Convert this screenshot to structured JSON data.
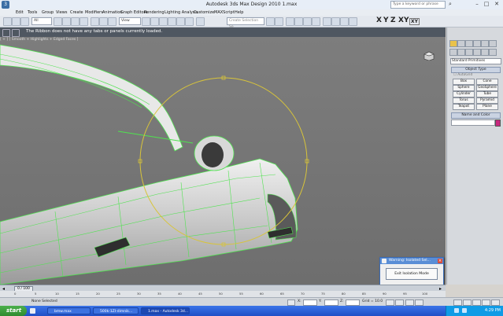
{
  "window": {
    "title": "Autodesk 3ds Max Design 2010     1.max",
    "search_placeholder": "Type a keyword or phrase"
  },
  "menu": {
    "items": [
      "Edit",
      "Tools",
      "Group",
      "Views",
      "Create",
      "Modifiers",
      "Animation",
      "Graph Editors",
      "Rendering",
      "Lighting Analysis",
      "Customize",
      "MAXScript",
      "Help"
    ]
  },
  "toolbar": {
    "filter_value": "All",
    "refcoord_value": "View",
    "named_selection_placeholder": "Create Selection Se",
    "axes": [
      "X",
      "Y",
      "Z",
      "XY",
      "XY"
    ]
  },
  "ribbon": {
    "message": "The Ribbon does not have any tabs or panels currently loaded."
  },
  "viewport": {
    "label": "[ + ] [ Smooth + Highlights + Edged Faces ]"
  },
  "command_panel": {
    "category_dropdown": "Standard Primitives",
    "object_type_header": "Object Type",
    "autogrid_label": "AutoGrid",
    "buttons": [
      "Box",
      "Cone",
      "Sphere",
      "GeoSphere",
      "Cylinder",
      "Tube",
      "Torus",
      "Pyramid",
      "Teapot",
      "Plane"
    ],
    "name_color_header": "Name and Color",
    "color_swatch": "#c8277e"
  },
  "dialog": {
    "title": "Warning: Isolated Sel...",
    "button_label": "Exit Isolation Mode"
  },
  "timeline": {
    "slider_label": "0 / 100",
    "ticks": [
      "0",
      "5",
      "10",
      "15",
      "20",
      "25",
      "30",
      "35",
      "40",
      "45",
      "50",
      "55",
      "60",
      "65",
      "70",
      "75",
      "80",
      "85",
      "90",
      "95",
      "100"
    ]
  },
  "status": {
    "selection_text": "None Selected",
    "x_label": "X:",
    "y_label": "Y:",
    "z_label": "Z:",
    "grid_text": "Grid = 10.0"
  },
  "taskbar": {
    "start_label": "start",
    "tasks": [
      "bmw.max",
      "500k-1ZI-dimnik...",
      "1.max - Autodesk 3d..."
    ],
    "clock": "4:29 PM"
  },
  "colors": {
    "viewport_bg": "#8a8a8a",
    "wireframe": "#4fe34f",
    "gizmo": "#d8c43a",
    "ribbon_bg": "#4f5761",
    "taskbar": "#2458d2"
  }
}
